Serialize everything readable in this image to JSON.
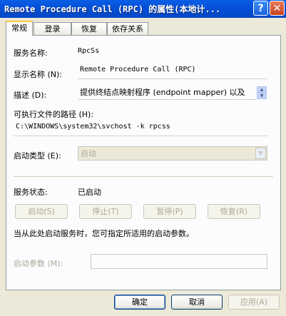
{
  "window": {
    "title": "Remote Procedure Call (RPC) 的属性(本地计...",
    "help_glyph": "?",
    "close_glyph": "✕"
  },
  "tabs": [
    {
      "label": "常规",
      "active": true
    },
    {
      "label": "登录",
      "active": false
    },
    {
      "label": "恢复",
      "active": false
    },
    {
      "label": "依存关系",
      "active": false
    }
  ],
  "general": {
    "service_name_label": "服务名称:",
    "service_name_value": "RpcSs",
    "display_name_label": "显示名称 (N):",
    "display_name_value": "Remote Procedure Call (RPC)",
    "description_label": "描述 (D):",
    "description_value": "提供终结点映射程序 (endpoint mapper) 以及",
    "exe_path_label": "可执行文件的路径 (H):",
    "exe_path_value": "C:\\WINDOWS\\system32\\svchost -k rpcss",
    "startup_type_label": "启动类型 (E):",
    "startup_type_value": "自动",
    "service_status_label": "服务状态:",
    "service_status_value": "已启动",
    "start_button": "启动(S)",
    "stop_button": "停止(T)",
    "pause_button": "暂停(P)",
    "resume_button": "恢复(R)",
    "hint_text": "当从此处启动服务时，您可指定所适用的启动参数。",
    "start_params_label": "启动参数 (M):",
    "start_params_value": ""
  },
  "dialog_buttons": {
    "ok": "确定",
    "cancel": "取消",
    "apply": "应用(A)"
  }
}
